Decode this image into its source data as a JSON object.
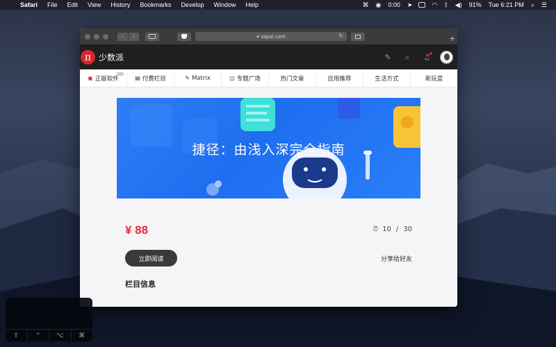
{
  "menubar": {
    "apple": "",
    "items": [
      "Safari",
      "File",
      "Edit",
      "View",
      "History",
      "Bookmarks",
      "Develop",
      "Window",
      "Help"
    ],
    "right": {
      "timer": "0:00",
      "battery": "91%",
      "clock": "Tue 6:21 PM"
    }
  },
  "browser": {
    "url": "sspai.com"
  },
  "site": {
    "logo_char": "π",
    "logo_text": "少数派"
  },
  "nav": {
    "items": [
      {
        "label": "正版软件",
        "icon": "store-icon"
      },
      {
        "label": "付费栏目",
        "icon": "book-icon"
      },
      {
        "label": "Matrix",
        "icon": "pen-icon"
      },
      {
        "label": "专题广场",
        "icon": "bag-icon"
      },
      {
        "label": "热门文章",
        "icon": ""
      },
      {
        "label": "应用推荐",
        "icon": ""
      },
      {
        "label": "生活方式",
        "icon": ""
      },
      {
        "label": "新玩意",
        "icon": ""
      }
    ]
  },
  "course": {
    "banner_title": "捷径：由浅入深完全指南",
    "price": "¥ 88",
    "progress_current": "10",
    "progress_sep": "/",
    "progress_total": "30",
    "read_button": "立即阅读",
    "share": "分享给好友",
    "section_title": "栏目信息"
  },
  "touchbar": {
    "keys": [
      "⇧",
      "⌃",
      "⌥",
      "⌘"
    ]
  },
  "colors": {
    "brand_red": "#d7282d",
    "price_red": "#e02c38",
    "banner_blue": "#2f7df5"
  }
}
